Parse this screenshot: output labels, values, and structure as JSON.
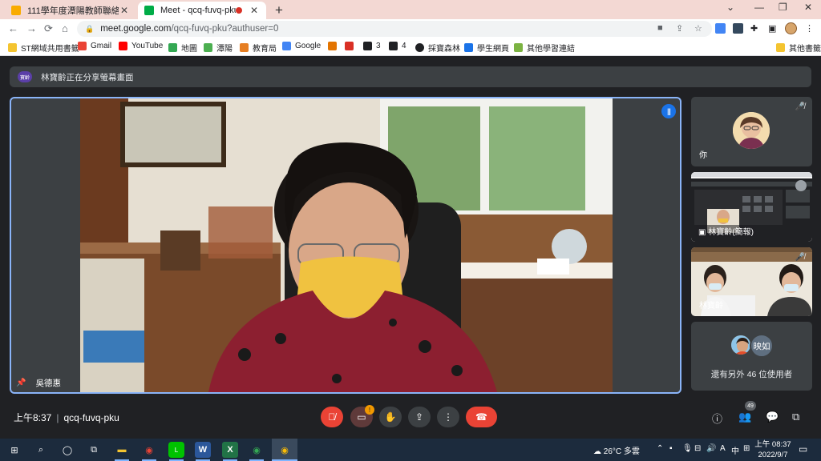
{
  "browser": {
    "tabs": [
      {
        "title": "111學年度潭陽教師聯絡教室",
        "favicon_color": "#f9ab00"
      },
      {
        "title": "Meet - qcq-fuvq-pku",
        "favicon_color": "#00ac47",
        "recording_indicator": true
      }
    ],
    "new_tab": "+",
    "url_host": "meet.google.com",
    "url_path": "/qcq-fuvq-pku?authuser=0",
    "bookmarks": [
      {
        "label": "ST網域共用書籤",
        "icon_color": "#f4c430"
      },
      {
        "label": "Gmail",
        "icon_color": "#ea4335"
      },
      {
        "label": "YouTube",
        "icon_color": "#ff0000"
      },
      {
        "label": "地圖",
        "icon_color": "#34a853"
      },
      {
        "label": "潭陽",
        "icon_color": "#4caf50"
      },
      {
        "label": "教育局",
        "icon_color": "#e67e22"
      },
      {
        "label": "Google",
        "icon_color": "#4285f4"
      },
      {
        "label": "",
        "icon_color": "#e37400"
      },
      {
        "label": "",
        "icon_color": "#d93025"
      },
      {
        "label": "3",
        "icon_color": "#202124"
      },
      {
        "label": "4",
        "icon_color": "#202124"
      },
      {
        "label": "採寶森林",
        "icon_color": "#202124"
      },
      {
        "label": "學生網頁",
        "icon_color": "#1a73e8"
      },
      {
        "label": "其他學習連結",
        "icon_color": "#7cb342"
      },
      {
        "label": "其他書籤",
        "icon_color": "#f4c430"
      }
    ]
  },
  "meet": {
    "banner": {
      "badge": "寶齡",
      "text": "林寶齡正在分享螢幕畫面"
    },
    "main_speaker": {
      "name": "吳德惠"
    },
    "participants": [
      {
        "label": "你",
        "muted": true
      },
      {
        "label": "林寶齡(簡報)",
        "muted": false
      },
      {
        "label": "林寶齡",
        "muted": true
      }
    ],
    "others": {
      "initials": "映如",
      "text": "還有另外 46 位使用者"
    },
    "time": "上午8:37",
    "meeting_code": "qcq-fuvq-pku",
    "camera_alert": "!",
    "people_count": "49"
  },
  "taskbar": {
    "weather": "26°C 多雲",
    "ime": "中",
    "time": "上午 08:37",
    "date": "2022/9/7"
  },
  "colors": {
    "accent": "#8ab4f8",
    "danger": "#ea4335",
    "meet_bg": "#202124"
  }
}
